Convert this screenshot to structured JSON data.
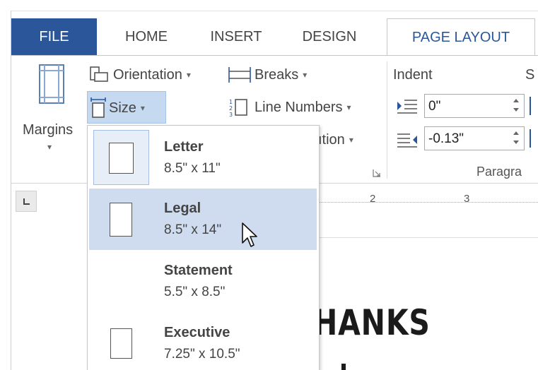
{
  "tabs": {
    "file": "FILE",
    "home": "HOME",
    "insert": "INSERT",
    "design": "DESIGN",
    "page_layout": "PAGE LAYOUT"
  },
  "ribbon": {
    "margins_label": "Margins",
    "orientation_label": "Orientation",
    "size_label": "Size",
    "breaks_label": "Breaks",
    "line_numbers_label": "Line Numbers",
    "hyphenation_partial": "ıtion",
    "indent_header": "Indent",
    "spacing_partial": "S",
    "indent_left_value": "0\"",
    "indent_right_value": "-0.13\"",
    "group_paragraph_partial": "Paragra"
  },
  "ruler": {
    "mark_2": "2",
    "mark_3": "3"
  },
  "document": {
    "heading_partial": "HANKS"
  },
  "size_menu": {
    "items": [
      {
        "name": "Letter",
        "dims": "8.5\" x 11\""
      },
      {
        "name": "Legal",
        "dims": "8.5\" x 14\""
      },
      {
        "name": "Statement",
        "dims": "5.5\" x 8.5\""
      },
      {
        "name": "Executive",
        "dims": "7.25\" x 10.5\""
      }
    ]
  },
  "colors": {
    "file_tab_bg": "#2b579a",
    "active_tab_text": "#2b579a",
    "hover_item_bg": "#cfdcef",
    "size_button_bg": "#c5d9f1"
  }
}
